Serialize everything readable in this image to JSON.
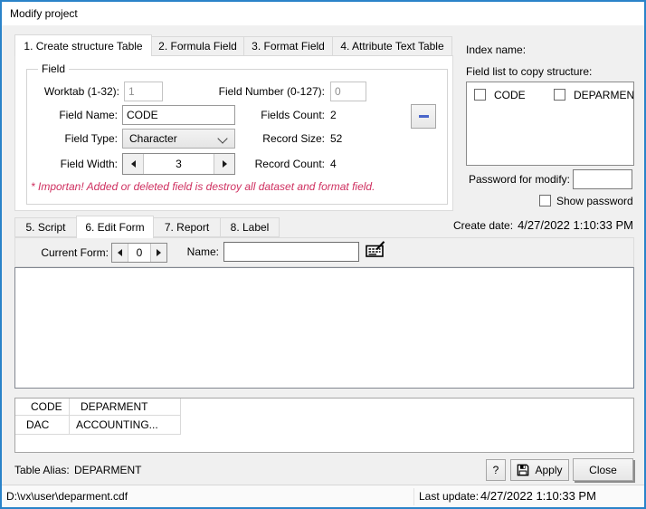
{
  "window": {
    "title": "Modify project"
  },
  "colors": {
    "accent": "#2a83c9",
    "warning_text": "#cf3060",
    "minus_icon": "#4a66c9"
  },
  "tabs_top": [
    {
      "label": "1. Create structure Table",
      "selected": true
    },
    {
      "label": "2. Formula Field",
      "selected": false
    },
    {
      "label": "3. Format Field",
      "selected": false
    },
    {
      "label": "4. Attribute Text Table",
      "selected": false
    }
  ],
  "field_group": {
    "title": "Field",
    "worktab_label": "Worktab (1-32):",
    "worktab_value": "1",
    "field_number_label": "Field Number (0-127):",
    "field_number_value": "0",
    "field_name_label": "Field Name:",
    "field_name_value": "CODE",
    "fields_count_label": "Fields Count:",
    "fields_count_value": "2",
    "field_type_label": "Field Type:",
    "field_type_value": "Character",
    "record_size_label": "Record Size:",
    "record_size_value": "52",
    "field_width_label": "Field Width:",
    "field_width_value": "3",
    "record_count_label": "Record Count:",
    "record_count_value": "4",
    "warning": "* Importan! Added or deleted field is destroy all dataset and format field."
  },
  "panel_right": {
    "index_name_label": "Index name:",
    "field_list_label": "Field list to copy structure:",
    "field_list_items": [
      {
        "label": "CODE",
        "checked": false
      },
      {
        "label": "DEPARMENT",
        "checked": false
      }
    ],
    "password_label": "Password for modify:",
    "password_value": "",
    "show_password_label": "Show password",
    "show_password_checked": false,
    "create_date_label": "Create date:",
    "create_date_value": "4/27/2022 1:10:33 PM"
  },
  "tabs_bottom": [
    {
      "label": "5. Script",
      "selected": false
    },
    {
      "label": "6. Edit Form",
      "selected": true
    },
    {
      "label": "7. Report",
      "selected": false
    },
    {
      "label": "8. Label",
      "selected": false
    }
  ],
  "form_toolbar": {
    "current_form_label": "Current Form:",
    "current_form_value": "0",
    "name_label": "Name:",
    "name_value": ""
  },
  "data_table": {
    "columns": [
      "CODE",
      "DEPARMENT"
    ],
    "rows": [
      [
        "DAC",
        "ACCOUNTING..."
      ]
    ]
  },
  "footer": {
    "table_alias_label": "Table Alias:",
    "table_alias_value": "DEPARMENT",
    "help_button_label": "?",
    "apply_button_label": "Apply",
    "close_button_label": "Close"
  },
  "status_bar": {
    "file_path": "D:\\vx\\user\\deparment.cdf",
    "last_update_label": "Last update:",
    "last_update_value": "4/27/2022 1:10:33 PM"
  },
  "icons": {
    "remove_field": "minus",
    "field_type_dropdown": "chevron-down",
    "field_width_spinner": "left-right-arrows",
    "current_form_spinner": "left-right-arrows",
    "form_name_tool": "keyboard-pen",
    "apply": "floppy-disk"
  }
}
